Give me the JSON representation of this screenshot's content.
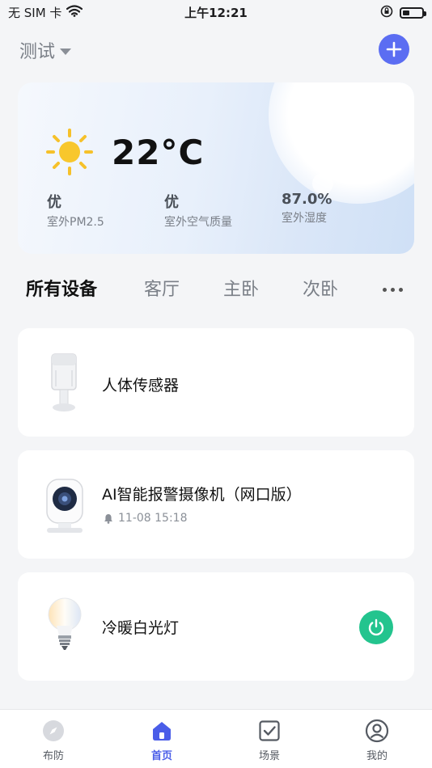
{
  "status_bar": {
    "carrier": "无 SIM 卡",
    "time": "上午12:21",
    "battery_level": 0.35
  },
  "header": {
    "home_name": "测试"
  },
  "weather": {
    "temperature": "22°C",
    "metrics": [
      {
        "value": "优",
        "label": "室外PM2.5"
      },
      {
        "value": "优",
        "label": "室外空气质量"
      },
      {
        "value": "87.0%",
        "label": "室外湿度"
      }
    ]
  },
  "tabs": [
    {
      "label": "所有设备",
      "active": true
    },
    {
      "label": "客厅",
      "active": false
    },
    {
      "label": "主卧",
      "active": false
    },
    {
      "label": "次卧",
      "active": false
    }
  ],
  "devices": [
    {
      "name": "人体传感器",
      "icon": "motion-sensor-icon"
    },
    {
      "name": "AI智能报警摄像机（网口版）",
      "meta": "11-08 15:18",
      "icon": "camera-icon"
    },
    {
      "name": "冷暖白光灯",
      "icon": "bulb-icon",
      "power": "on"
    }
  ],
  "bottom_nav": [
    {
      "label": "布防",
      "icon": "compass-icon"
    },
    {
      "label": "首页",
      "icon": "home-icon",
      "active": true
    },
    {
      "label": "场景",
      "icon": "checkbox-icon"
    },
    {
      "label": "我的",
      "icon": "user-icon"
    }
  ],
  "colors": {
    "accent": "#5b6df2",
    "power_on": "#23c48e",
    "nav_active": "#4a5de8"
  }
}
